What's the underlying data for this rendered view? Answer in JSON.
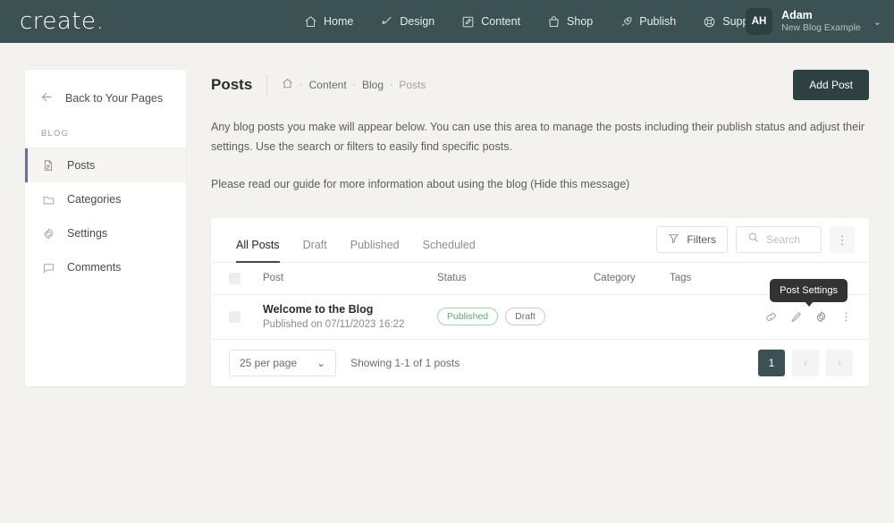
{
  "header": {
    "brand": "create",
    "brand_dot": ".",
    "nav": [
      {
        "label": "Home",
        "icon": "home-icon"
      },
      {
        "label": "Design",
        "icon": "brush-icon"
      },
      {
        "label": "Content",
        "icon": "edit-square-icon"
      },
      {
        "label": "Shop",
        "icon": "bag-icon"
      },
      {
        "label": "Publish",
        "icon": "rocket-icon"
      },
      {
        "label": "Support",
        "icon": "lifebuoy-icon"
      }
    ],
    "account": {
      "initials": "AH",
      "name": "Adam",
      "site": "New Blog Example",
      "caret": "⌄"
    }
  },
  "sidebar": {
    "back_label": "Back to Your Pages",
    "section_label": "BLOG",
    "items": [
      {
        "label": "Posts",
        "icon": "document-icon",
        "active": true
      },
      {
        "label": "Categories",
        "icon": "folder-icon",
        "active": false
      },
      {
        "label": "Settings",
        "icon": "gear-icon",
        "active": false
      },
      {
        "label": "Comments",
        "icon": "comment-icon",
        "active": false
      }
    ]
  },
  "page": {
    "title": "Posts",
    "breadcrumb": {
      "home_icon": "home-icon",
      "sep": "-",
      "items": [
        "Content",
        "Blog",
        "Posts"
      ]
    },
    "add_button": "Add Post",
    "description_1": "Any blog posts you make will appear below. You can use this area to manage the posts including their publish status and adjust their settings. Use the search or filters to easily find specific posts.",
    "description_2": "Please read our guide for more information about using the blog (Hide this message)"
  },
  "card": {
    "tabs": [
      {
        "label": "All Posts",
        "active": true
      },
      {
        "label": "Draft",
        "active": false
      },
      {
        "label": "Published",
        "active": false
      },
      {
        "label": "Scheduled",
        "active": false
      }
    ],
    "filters_label": "Filters",
    "search_placeholder": "Search",
    "search_value": "",
    "kebab": "⋮",
    "columns": {
      "post": "Post",
      "status": "Status",
      "category": "Category",
      "tags": "Tags"
    },
    "rows": [
      {
        "title": "Welcome to the Blog",
        "subtitle": "Published on 07/11/2023 16:22",
        "badges": [
          {
            "label": "Published",
            "style": "green"
          },
          {
            "label": "Draft",
            "style": "grey"
          }
        ],
        "category": "",
        "tags": "",
        "actions": [
          "link-icon",
          "pencil-icon",
          "gear-icon",
          "kebab-icon"
        ]
      }
    ],
    "tooltip": "Post Settings",
    "footer": {
      "per_page": "25 per page",
      "per_page_caret": "⌄",
      "showing": "Showing 1-1 of 1 posts",
      "pages": [
        {
          "label": "1",
          "state": "current"
        },
        {
          "label": "‹",
          "state": "disabled"
        },
        {
          "label": "›",
          "state": "disabled"
        }
      ]
    }
  },
  "colors": {
    "topbar": "#3c5153",
    "page_bg": "#f4f2ee",
    "accent_active": "#6b6f9e",
    "badge_green": "#5aa96a",
    "button_dark": "#2e4042"
  }
}
